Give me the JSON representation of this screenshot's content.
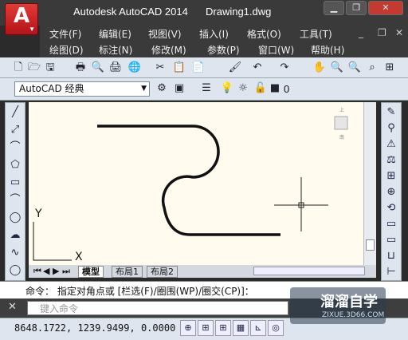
{
  "title": {
    "app": "Autodesk AutoCAD 2014",
    "document": "Drawing1.dwg",
    "app_button": "A"
  },
  "window_buttons": [
    "▁",
    "❐",
    "✕"
  ],
  "doc_buttons": [
    "_",
    "❐",
    "✕"
  ],
  "menu_row1": [
    "文件(F)",
    "编辑(E)",
    "视图(V)",
    "插入(I)",
    "格式(O)",
    "工具(T)"
  ],
  "menu_row2": [
    "绘图(D)",
    "标注(N)",
    "修改(M)",
    "参数(P)",
    "窗口(W)",
    "帮助(H)"
  ],
  "toolbar1": [
    "🗋",
    "🗁",
    "🖫",
    "🖶",
    "🔍",
    "🖨",
    "🌐",
    "✂",
    "📋",
    "📄",
    "🖌",
    "↶",
    "↷",
    "✋",
    "🔍",
    "🔍",
    "⌕",
    "⊞",
    "⊞"
  ],
  "workspace": {
    "value": "AutoCAD 经典"
  },
  "layer": {
    "value": "0",
    "icons": [
      "⚙",
      "▣",
      "☰",
      "💡",
      "☼",
      "🔓",
      "■"
    ]
  },
  "left_tools": [
    "╱",
    "⤢",
    "⌒",
    "⬠",
    "▭",
    "⌒",
    "◯",
    "☁",
    "∿",
    "◯"
  ],
  "right_tools": [
    "✎",
    "⚲",
    "⚠",
    "⚖",
    "⊞",
    "⊕",
    "⟲",
    "▭",
    "▭",
    "⊔",
    "⊢"
  ],
  "viewcube": {
    "top": "上",
    "bottom": "南"
  },
  "ucs": {
    "x": "X",
    "y": "Y"
  },
  "tabs": {
    "nav": [
      "⏮",
      "◀",
      "▶",
      "⏭"
    ],
    "model": "模型",
    "layout1": "布局1",
    "layout2": "布局2"
  },
  "command": {
    "line": "命令： 指定对角点或 [栏选(F)/圈围(WP)/圈交(CP)]：",
    "placeholder": "键入命令"
  },
  "status": {
    "coords": "8648.1722,  1239.9499, 0.0000",
    "icons": [
      "⊕",
      "⊞",
      "⊞",
      "▦",
      "⊾",
      "◎",
      "◻",
      "∠",
      "⊹",
      "+",
      "☰",
      "◫"
    ]
  },
  "watermark": {
    "title": "溜溜自学",
    "subtitle": "ZIXUE.3D66.COM"
  }
}
